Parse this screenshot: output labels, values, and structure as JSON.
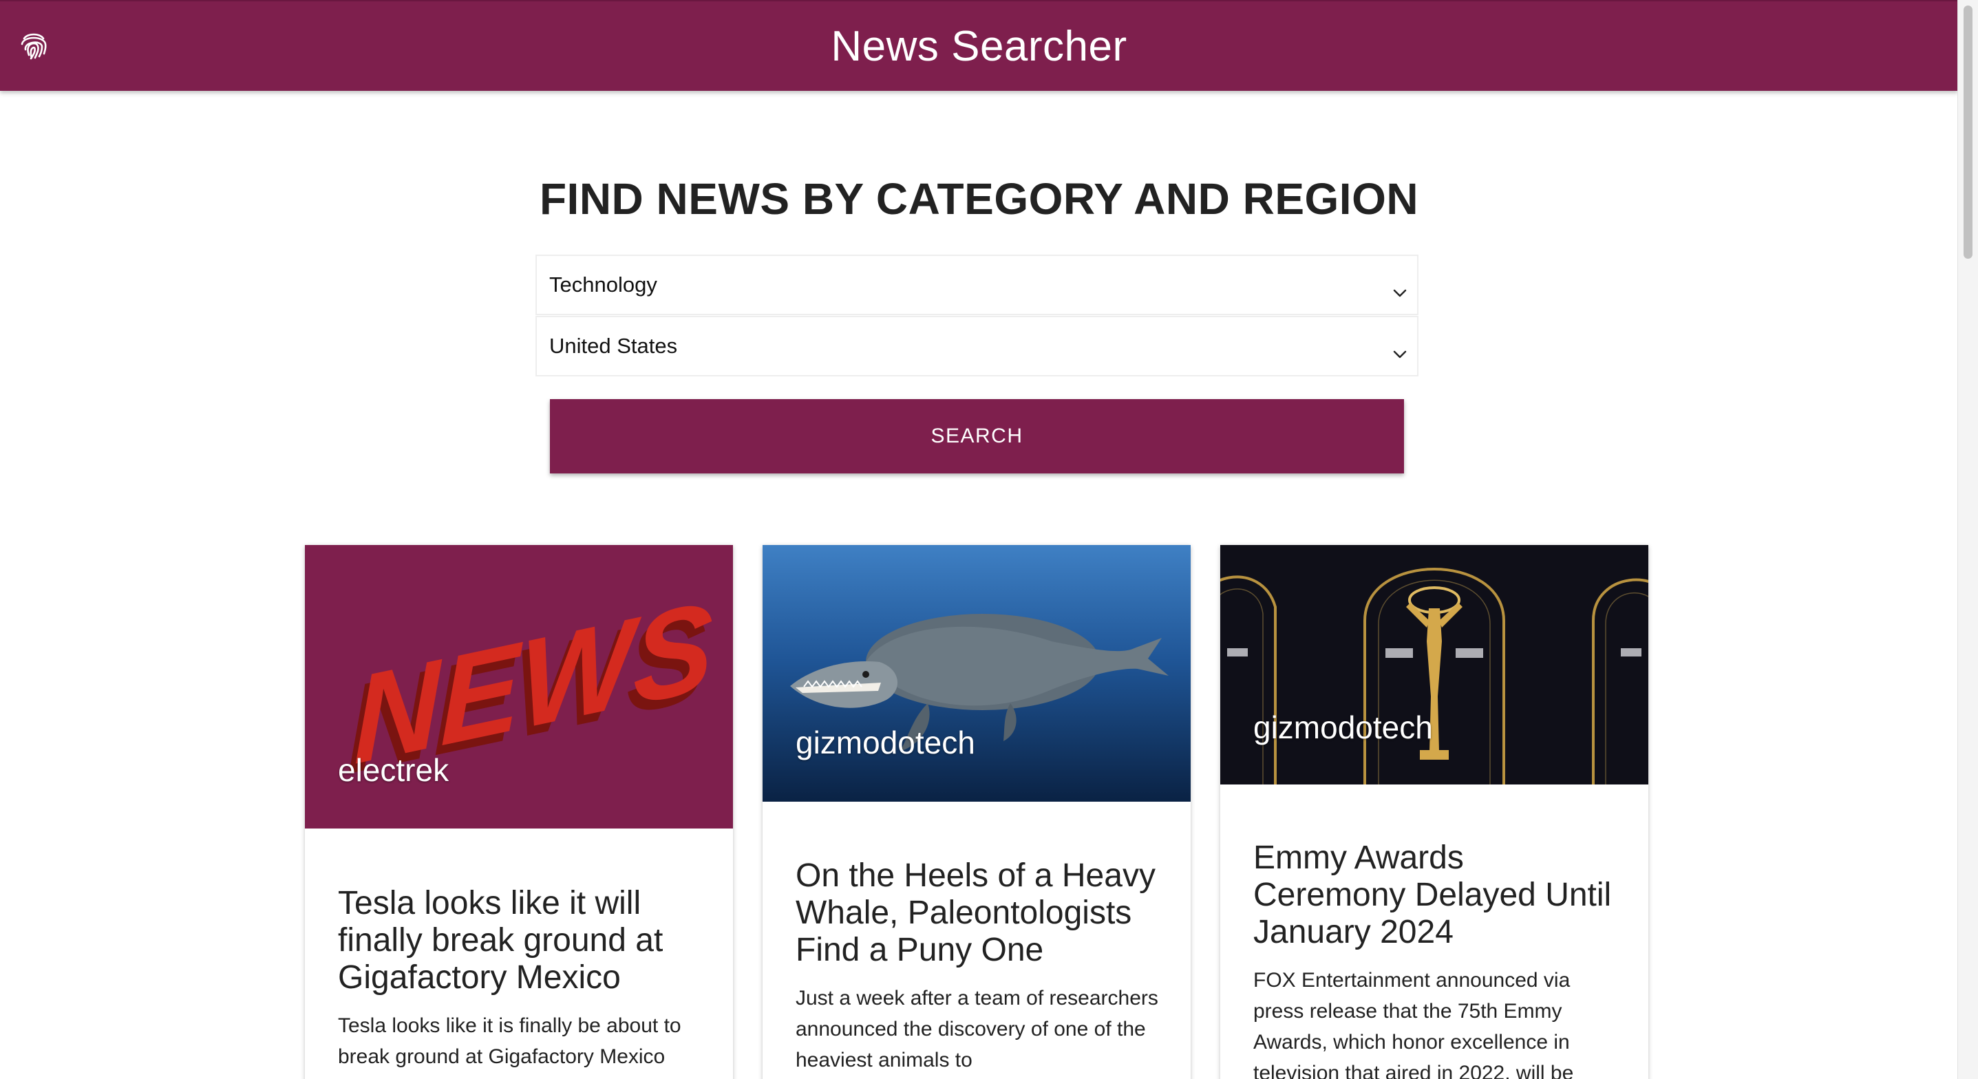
{
  "app": {
    "title": "News Searcher",
    "brand_icon": "fingerprint-icon",
    "accent_color": "#7e1f4d"
  },
  "search": {
    "heading": "FIND NEWS BY CATEGORY AND REGION",
    "category": {
      "selected": "Technology",
      "icon": "chevron-down-icon"
    },
    "region": {
      "selected": "United States",
      "icon": "chevron-down-icon"
    },
    "button_label": "SEARCH"
  },
  "articles": [
    {
      "source": "electrek",
      "image_text": "NEWS",
      "title": "Tesla looks like it will finally break ground at Gigafactory Mexico",
      "description": "Tesla looks like it is finally be about to break ground at Gigafactory Mexico"
    },
    {
      "source": "gizmodotech",
      "title": "On the Heels of a Heavy Whale, Paleontologists Find a Puny One",
      "description": "Just a week after a team of researchers announced the discovery of one of the heaviest animals to"
    },
    {
      "source": "gizmodotech",
      "title": "Emmy Awards Ceremony Delayed Until January 2024",
      "description": "FOX Entertainment announced via press release that the 75th Emmy Awards, which honor excellence in television that aired in 2022, will be"
    }
  ]
}
